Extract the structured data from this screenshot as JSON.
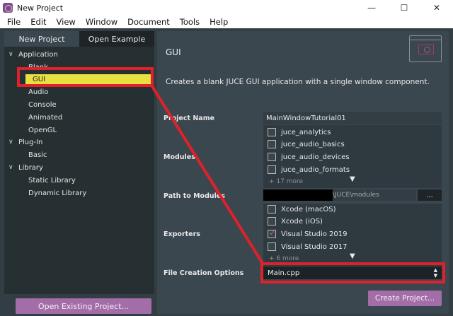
{
  "window": {
    "title": "New Project",
    "minimize_glyph": "—",
    "maximize_glyph": "☐",
    "close_glyph": "✕"
  },
  "menu": [
    "File",
    "Edit",
    "View",
    "Window",
    "Document",
    "Tools",
    "Help"
  ],
  "tabs": {
    "new_project": "New Project",
    "open_example": "Open Example"
  },
  "tree": {
    "application": "Application",
    "blank": "Blank",
    "gui": "GUI",
    "audio": "Audio",
    "console": "Console",
    "animated": "Animated",
    "opengl": "OpenGL",
    "plugin": "Plug-In",
    "basic": "Basic",
    "library": "Library",
    "static_library": "Static Library",
    "dynamic_library": "Dynamic Library"
  },
  "open_existing_label": "Open Existing Project...",
  "detail": {
    "title": "GUI",
    "description": "Creates a blank JUCE GUI application with a single window component."
  },
  "fields": {
    "project_name_label": "Project Name",
    "project_name_value": "MainWindowTutorial01",
    "modules_label": "Modules",
    "modules": [
      {
        "label": "juce_analytics",
        "checked": false
      },
      {
        "label": "juce_audio_basics",
        "checked": false
      },
      {
        "label": "juce_audio_devices",
        "checked": false
      },
      {
        "label": "juce_audio_formats",
        "checked": false
      }
    ],
    "modules_more": "+ 17 more",
    "path_label": "Path to Modules",
    "path_value": "\\JUCE\\modules",
    "path_button": "...",
    "exporters_label": "Exporters",
    "exporters": [
      {
        "label": "Xcode (macOS)",
        "checked": false
      },
      {
        "label": "Xcode (iOS)",
        "checked": false
      },
      {
        "label": "Visual Studio 2019",
        "checked": true
      },
      {
        "label": "Visual Studio 2017",
        "checked": false
      }
    ],
    "exporters_more": "+ 6 more",
    "file_creation_label": "File Creation Options",
    "file_creation_value": "Main.cpp"
  },
  "create_label": "Create Project...",
  "colors": {
    "background": "#323e44",
    "panel": "#3b474e",
    "tree_bg": "#263033",
    "selection": "#e7e040",
    "button": "#a36ea8",
    "annotation": "#e0202a"
  }
}
